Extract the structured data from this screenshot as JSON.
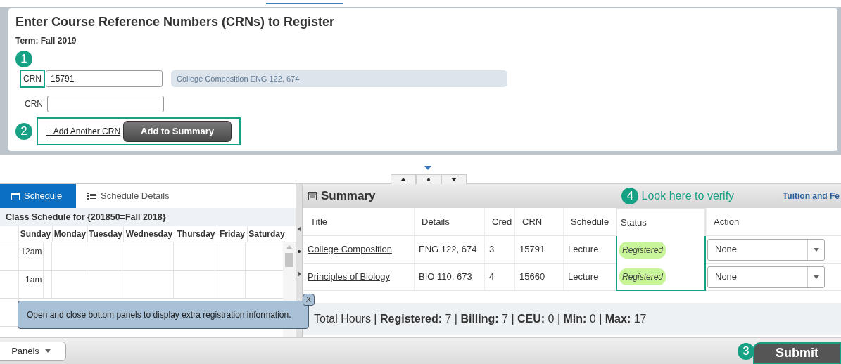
{
  "register": {
    "title": "Enter Course Reference Numbers (CRNs) to Register",
    "term": "Term: Fall 2019",
    "step_badge": "1",
    "crn_rows": [
      {
        "label": "CRN",
        "value": "15791",
        "description": "College Composition ENG 122, 674",
        "highlighted": true
      },
      {
        "label": "CRN",
        "highlighted": false
      }
    ],
    "action_badge": "2",
    "add_link": "+ Add Another CRN",
    "add_button": "Add to Summary"
  },
  "schedule_panel": {
    "tabs": [
      {
        "label": "Schedule",
        "selected": true
      },
      {
        "label": "Schedule Details",
        "selected": false
      }
    ],
    "heading": "Class Schedule for {201850=Fall 2018}",
    "days": [
      "Sunday",
      "Monday",
      "Tuesday",
      "Wednesday",
      "Thursday",
      "Friday",
      "Saturday"
    ],
    "times": [
      "12am",
      "1am"
    ]
  },
  "tooltip": {
    "text": "Open and close bottom panels to display extra registration information.",
    "close": "X"
  },
  "summary": {
    "title": "Summary",
    "callout_badge": "4",
    "callout_text": "Look here to verify",
    "link": "Tuition and Fe",
    "columns": [
      "Title",
      "Details",
      "Cred",
      "CRN",
      "Schedule",
      "Status",
      "Action"
    ],
    "rows": [
      {
        "title": "College Composition",
        "details": "ENG 122, 674",
        "credits": "3",
        "crn": "15791",
        "schedule": "Lecture",
        "status": "Registered",
        "action": "None"
      },
      {
        "title": "Principles of Biology",
        "details": "BIO 110, 673",
        "credits": "4",
        "crn": "15660",
        "schedule": "Lecture",
        "status": "Registered",
        "action": "None"
      }
    ],
    "totals": "Total Hours | **Registered:** 7 | **Billing:** 7 | **CEU:** 0 | **Min:** 0 | **Max:** 17"
  },
  "bottom_bar": {
    "panels_button": "Panels",
    "submit_badge": "3",
    "submit_button": "Submit"
  }
}
